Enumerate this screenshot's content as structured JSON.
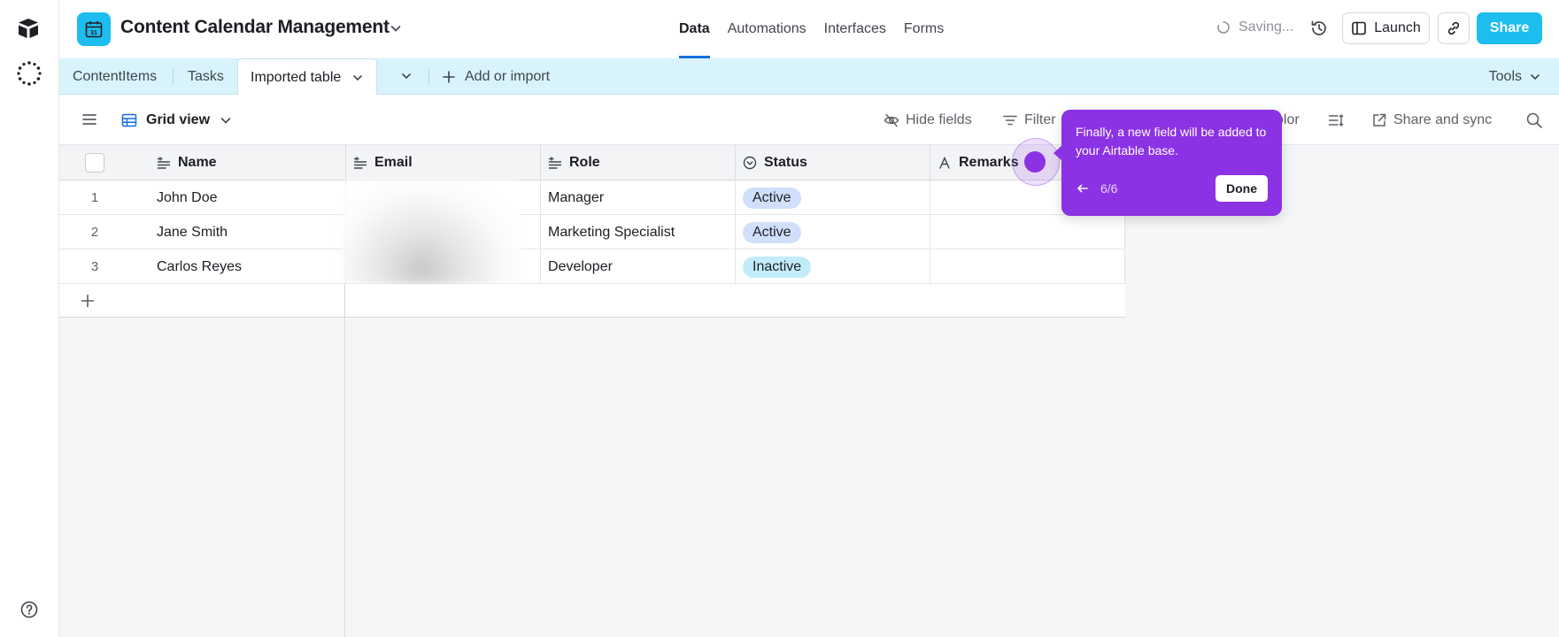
{
  "base": {
    "title": "Content Calendar Management",
    "icon": "calendar-icon",
    "icon_color": "#1dbdf0"
  },
  "nav": {
    "items": [
      "Data",
      "Automations",
      "Interfaces",
      "Forms"
    ],
    "active": "Data"
  },
  "header": {
    "saving_label": "Saving...",
    "launch_label": "Launch",
    "share_label": "Share",
    "share_color": "#1dbdf0"
  },
  "tabs": {
    "items": [
      "ContentItems",
      "Tasks",
      "Imported table"
    ],
    "active": "Imported table",
    "add_label": "Add or import",
    "tools_label": "Tools"
  },
  "view": {
    "name": "Grid view",
    "hide_fields": "Hide fields",
    "filter": "Filter",
    "color_partial": "olor",
    "share_sync": "Share and sync"
  },
  "table": {
    "columns": [
      {
        "label": "Name",
        "icon": "long-text-icon"
      },
      {
        "label": "Email",
        "icon": "long-text-icon"
      },
      {
        "label": "Role",
        "icon": "long-text-icon"
      },
      {
        "label": "Status",
        "icon": "single-select-icon"
      },
      {
        "label": "Remarks",
        "icon": "text-icon"
      }
    ],
    "rows": [
      {
        "num": "1",
        "name": "John Doe",
        "email": "",
        "role": "Manager",
        "status": "Active",
        "remarks": ""
      },
      {
        "num": "2",
        "name": "Jane Smith",
        "email": "",
        "role": "Marketing Specialist",
        "status": "Active",
        "remarks": ""
      },
      {
        "num": "3",
        "name": "Carlos Reyes",
        "email": "",
        "role": "Developer",
        "status": "Inactive",
        "remarks": ""
      }
    ],
    "status_colors": {
      "Active": "#cfdffc",
      "Inactive": "#c2ecfa"
    }
  },
  "tooltip": {
    "text": "Finally, a new field will be added to your Airtable base.",
    "step": "6/6",
    "done_label": "Done",
    "color": "#8b32e4"
  }
}
